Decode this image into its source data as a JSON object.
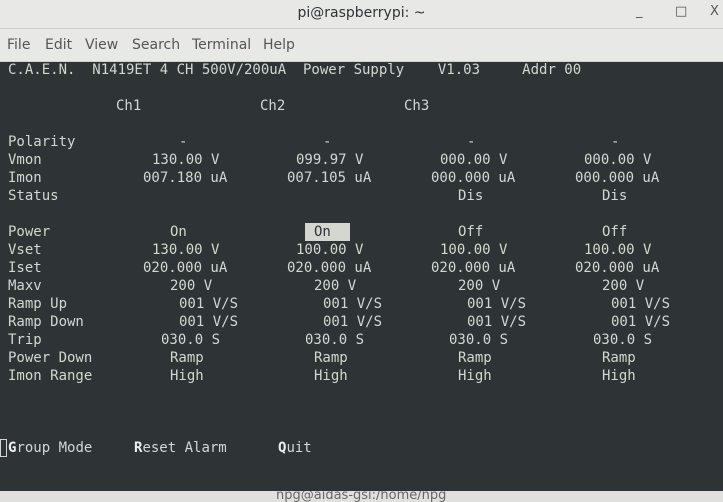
{
  "window": {
    "title": "pi@raspberrypi: ~",
    "minimize": "_",
    "maximize": "□",
    "close": "X"
  },
  "menu": [
    "File",
    "Edit",
    "View",
    "Search",
    "Terminal",
    "Help"
  ],
  "terminal": {
    "header": "C.A.E.N.  N1419ET 4 CH 500V/200uA  Power Supply    V1.03     Addr 00",
    "channels": [
      "Ch1",
      "Ch2",
      "Ch3"
    ],
    "rows": [
      {
        "label": "Polarity",
        "values": [
          "-",
          "-",
          "-",
          "-"
        ]
      },
      {
        "label": "Vmon",
        "values": [
          "130.00 V",
          "099.97 V",
          "000.00 V",
          "000.00 V"
        ]
      },
      {
        "label": "Imon",
        "values": [
          "007.180 uA",
          "007.105 uA",
          "000.000 uA",
          "000.000 uA"
        ]
      },
      {
        "label": "Status",
        "values": [
          "",
          "",
          "Dis",
          "Dis"
        ]
      },
      {
        "label": "Power",
        "values": [
          "On",
          "On",
          "Off",
          "Off"
        ],
        "selected": 1
      },
      {
        "label": "Vset",
        "values": [
          "130.00 V",
          "100.00 V",
          "100.00 V",
          "100.00 V"
        ]
      },
      {
        "label": "Iset",
        "values": [
          "020.000 uA",
          "020.000 uA",
          "020.000 uA",
          "020.000 uA"
        ]
      },
      {
        "label": "Maxv",
        "values": [
          "200 V",
          "200 V",
          "200 V",
          "200 V"
        ]
      },
      {
        "label": "Ramp Up",
        "values": [
          "001 V/S",
          "001 V/S",
          "001 V/S",
          "001 V/S"
        ]
      },
      {
        "label": "Ramp Down",
        "values": [
          "001 V/S",
          "001 V/S",
          "001 V/S",
          "001 V/S"
        ]
      },
      {
        "label": "Trip",
        "values": [
          "030.0 S",
          "030.0 S",
          "030.0 S",
          "030.0 S"
        ]
      },
      {
        "label": "Power Down",
        "values": [
          "Ramp",
          "Ramp",
          "Ramp",
          "Ramp"
        ]
      },
      {
        "label": "Imon Range",
        "values": [
          "High",
          "High",
          "High",
          "High"
        ]
      }
    ],
    "commands": [
      {
        "key": "G",
        "rest": "roup Mode"
      },
      {
        "key": "R",
        "rest": "eset Alarm"
      },
      {
        "key": "Q",
        "rest": "uit"
      }
    ]
  },
  "background_window": {
    "title": "npg@aidas-gsi:/home/npg"
  }
}
